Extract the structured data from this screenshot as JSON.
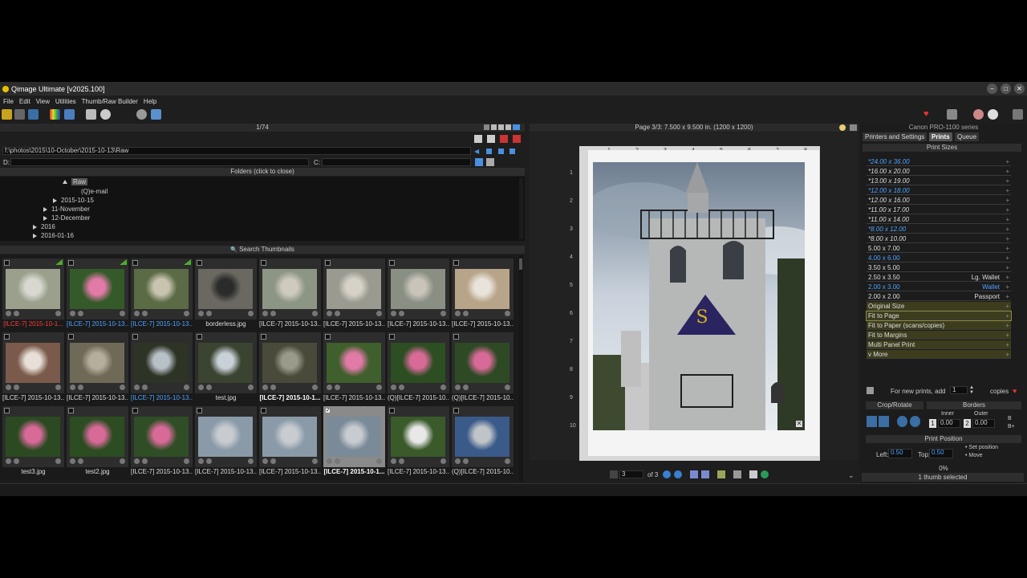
{
  "window": {
    "title": "Qimage Ultimate [v2025.100]",
    "controls": [
      "minimize",
      "maximize",
      "close"
    ]
  },
  "menu": [
    "File",
    "Edit",
    "View",
    "Utilities",
    "Thumb/Raw Builder",
    "Help"
  ],
  "left": {
    "counter": "1/74",
    "path": "f:\\photos\\2015\\10-October\\2015-10-13\\Raw",
    "d_label": "D:",
    "c_label": "C:",
    "folders_header": "Folders (click to close)",
    "search_label": "Search Thumbnails",
    "tree": [
      {
        "label": "Raw",
        "open": true
      },
      {
        "label": "(Q)e-mail",
        "open": null
      },
      {
        "label": "2015-10-15",
        "open": false
      },
      {
        "label": "11-November",
        "open": false
      },
      {
        "label": "12-December",
        "open": false
      },
      {
        "label": "2016",
        "open": false
      },
      {
        "label": "2016-01-16",
        "open": false
      }
    ],
    "thumbnails": [
      {
        "label": "[ILCE-7] 2015-10-1...",
        "style": "red",
        "img": "dog",
        "flag": true
      },
      {
        "label": "[ILCE-7] 2015-10-13...",
        "style": "blue",
        "img": "flower",
        "flag": true
      },
      {
        "label": "[ILCE-7] 2015-10-13...",
        "style": "blue",
        "img": "garden",
        "flag": true
      },
      {
        "label": "borderless.jpg",
        "style": "normal",
        "img": "building",
        "flag": false
      },
      {
        "label": "[ILCE-7] 2015-10-13...",
        "style": "normal",
        "img": "dog2",
        "flag": false
      },
      {
        "label": "[ILCE-7] 2015-10-13...",
        "style": "normal",
        "img": "dog3",
        "flag": false
      },
      {
        "label": "[ILCE-7] 2015-10-13...",
        "style": "normal",
        "img": "dog4",
        "flag": false
      },
      {
        "label": "[ILCE-7] 2015-10-13...",
        "style": "normal",
        "img": "cat",
        "flag": false
      },
      {
        "label": "[ILCE-7] 2015-10-13...",
        "style": "normal",
        "img": "window",
        "flag": false
      },
      {
        "label": "[ILCE-7] 2015-10-13...",
        "style": "normal",
        "img": "ruins",
        "flag": false
      },
      {
        "label": "[ILCE-7] 2015-10-13...",
        "style": "blue",
        "img": "trees",
        "flag": false
      },
      {
        "label": "test.jpg",
        "style": "normal",
        "img": "trees2",
        "flag": false
      },
      {
        "label": "[ILCE-7] 2015-10-1...",
        "style": "bold",
        "img": "path",
        "flag": false
      },
      {
        "label": "[ILCE-7] 2015-10-13...",
        "style": "normal",
        "img": "flower2",
        "flag": false
      },
      {
        "label": "(Q)[ILCE-7] 2015-10...",
        "style": "normal",
        "img": "flower3",
        "flag": false
      },
      {
        "label": "(Q)[ILCE-7] 2015-10...",
        "style": "normal",
        "img": "flower4",
        "flag": false
      },
      {
        "label": "test3.jpg",
        "style": "normal",
        "img": "flower5",
        "flag": false
      },
      {
        "label": "test2.jpg",
        "style": "normal",
        "img": "flower6",
        "flag": false
      },
      {
        "label": "[ILCE-7] 2015-10-13...",
        "style": "normal",
        "img": "flower7",
        "flag": false
      },
      {
        "label": "[ILCE-7] 2015-10-13...",
        "style": "normal",
        "img": "tower",
        "flag": false
      },
      {
        "label": "[ILCE-7] 2015-10-13...",
        "style": "normal",
        "img": "tower2",
        "flag": false
      },
      {
        "label": "[ILCE-7] 2015-10-1...",
        "style": "boldsel",
        "img": "tower3",
        "flag": false,
        "selected": true
      },
      {
        "label": "[ILCE-7] 2015-10-13...",
        "style": "normal",
        "img": "horse",
        "flag": false
      },
      {
        "label": "(Q)[ILCE-7] 2015-10...",
        "style": "normal",
        "img": "castle",
        "flag": false
      }
    ]
  },
  "preview": {
    "header": "Page 3/3: 7.500 x 9.500 in.  (1200 x 1200)",
    "page_value": "3",
    "page_of": "of 3",
    "ruler_top": [
      "1",
      "2",
      "3",
      "4",
      "5",
      "6",
      "7",
      "8"
    ],
    "ruler_left": [
      "1",
      "2",
      "3",
      "4",
      "5",
      "6",
      "7",
      "8",
      "9",
      "10"
    ]
  },
  "right": {
    "printer": "Canon PRO-1100 series",
    "tabs": [
      "Printers and Settings",
      "Prints",
      "Queue"
    ],
    "active_tab": "Prints",
    "print_sizes_header": "Print Sizes",
    "sizes": [
      {
        "label": "*24.00 x 36.00",
        "right": "",
        "color": "#4da3ff",
        "italic": true
      },
      {
        "label": "*16.00 x 20.00",
        "right": "",
        "color": "#dddddd",
        "italic": true
      },
      {
        "label": "*13.00 x 19.00",
        "right": "",
        "color": "#dddddd",
        "italic": true
      },
      {
        "label": "*12.00 x 18.00",
        "right": "",
        "color": "#4da3ff",
        "italic": true
      },
      {
        "label": "*12.00 x 16.00",
        "right": "",
        "color": "#dddddd",
        "italic": true
      },
      {
        "label": "*11.00 x 17.00",
        "right": "",
        "color": "#dddddd",
        "italic": true
      },
      {
        "label": "*11.00 x 14.00",
        "right": "",
        "color": "#dddddd",
        "italic": true
      },
      {
        "label": "*8.00 x 12.00",
        "right": "",
        "color": "#4da3ff",
        "italic": true
      },
      {
        "label": "*8.00 x 10.00",
        "right": "",
        "color": "#dddddd",
        "italic": true
      },
      {
        "label": "5.00 x 7.00",
        "right": "",
        "color": "#dddddd",
        "italic": false
      },
      {
        "label": "4.00 x 6.00",
        "right": "",
        "color": "#4da3ff",
        "italic": false
      },
      {
        "label": "3.50 x 5.00",
        "right": "",
        "color": "#dddddd",
        "italic": false
      },
      {
        "label": "2.50 x 3.50",
        "right": "Lg. Wallet",
        "color": "#dddddd",
        "italic": false
      },
      {
        "label": "2.00 x 3.00",
        "right": "Wallet",
        "color": "#4da3ff",
        "italic": false
      },
      {
        "label": "2.00 x 2.00",
        "right": "Passport",
        "color": "#dddddd",
        "italic": false
      },
      {
        "label": "Original Size",
        "right": "",
        "color": "#dddddd",
        "italic": false,
        "olive": true
      },
      {
        "label": "Fit to Page",
        "right": "",
        "color": "#dddddd",
        "italic": false,
        "olive": true,
        "active": true
      },
      {
        "label": "Fit to Paper (scans/copies)",
        "right": "",
        "color": "#dddddd",
        "italic": false,
        "olive": true
      },
      {
        "label": "Fit to Margins",
        "right": "",
        "color": "#dddddd",
        "italic": false,
        "olive": true
      },
      {
        "label": "Multi Panel Print",
        "right": "",
        "color": "#dddddd",
        "italic": false,
        "olive": true
      },
      {
        "label": "v More",
        "right": "",
        "color": "#dddddd",
        "italic": false,
        "olive": true
      }
    ],
    "new_prints_label": "For new prints, add",
    "copies_value": "1",
    "copies_label": "copies",
    "crop_rotate": "Crop/Rotate",
    "borders": "Borders",
    "inner": "Inner",
    "outer": "Outer",
    "inner_val": "0.00",
    "outer_val": "0.00",
    "inner_num": "1",
    "outer_num": "2",
    "b_label": "B",
    "bplus_label": "B+",
    "print_position": "Print Position",
    "left_label": "Left:",
    "left_val": "0.50",
    "top_label": "Top:",
    "top_val": "0.50",
    "set_position": "Set position",
    "move": "Move",
    "progress": "0%",
    "status": "1 thumb selected"
  },
  "colors": {
    "blue": "#4da3ff",
    "red": "#ff3b3b",
    "olive": "#3d3d1e",
    "accent": "#3a5f9a"
  }
}
